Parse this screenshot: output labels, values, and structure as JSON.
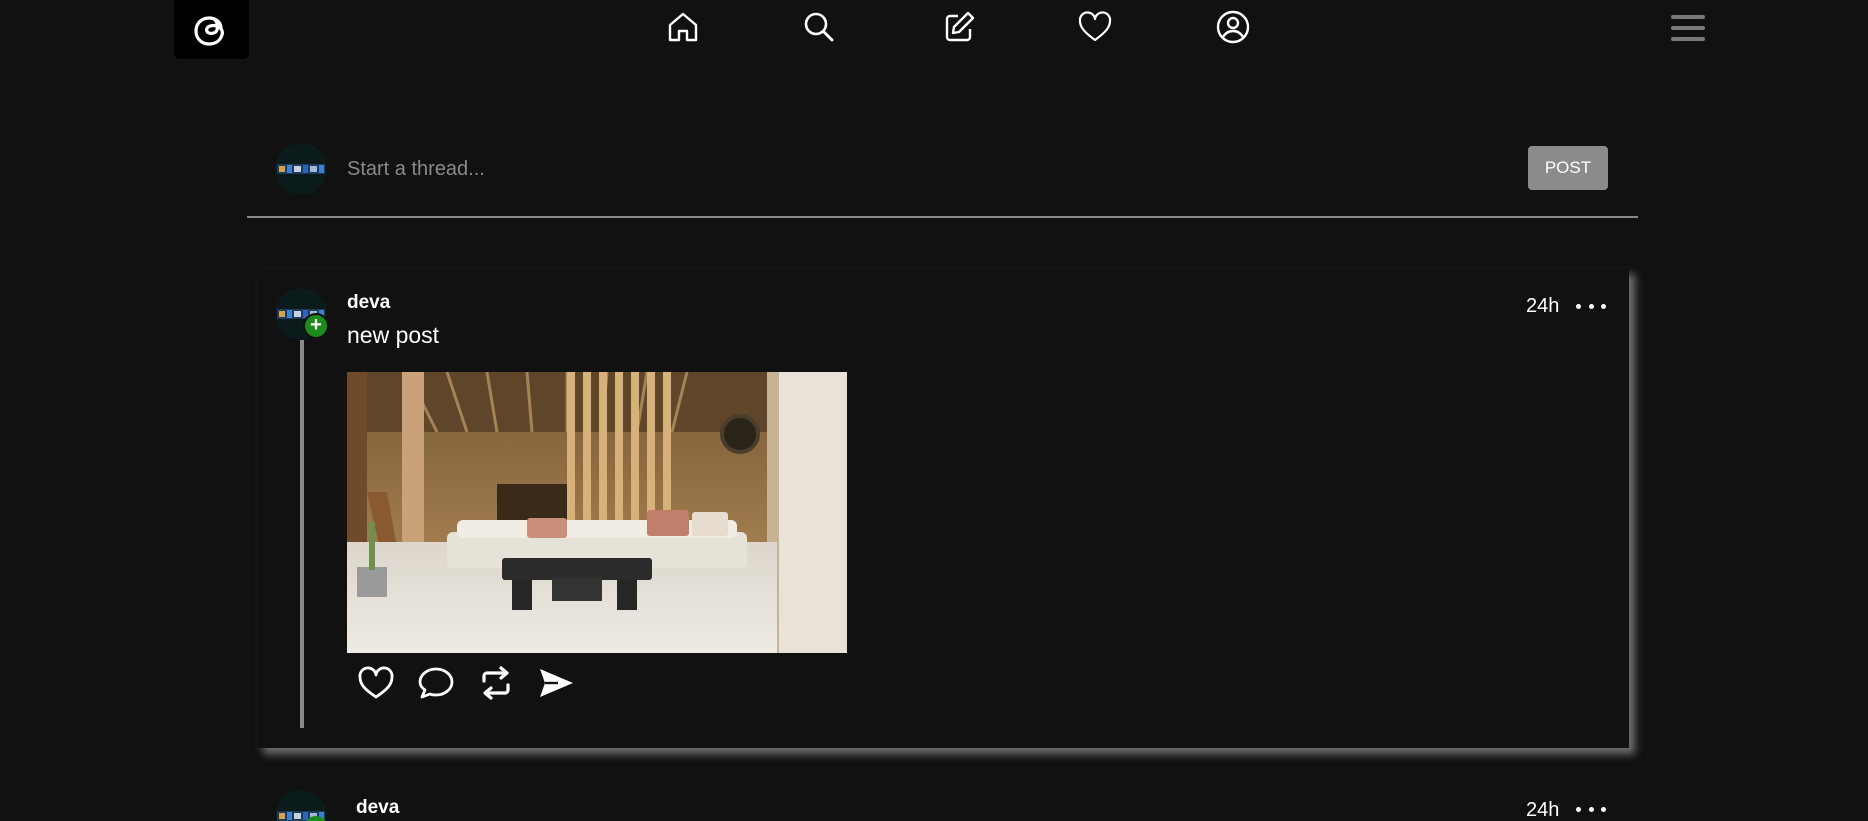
{
  "nav": {
    "logo": "threads-logo-icon",
    "icons": [
      "home-icon",
      "search-icon",
      "compose-icon",
      "heart-icon",
      "profile-icon"
    ],
    "menu": "hamburger-menu-icon"
  },
  "composer": {
    "placeholder": "Start a thread...",
    "post_label": "POST"
  },
  "posts": [
    {
      "username": "deva",
      "text": "new post",
      "time": "24h",
      "image": "living-room-photo",
      "actions": [
        "like-icon",
        "comment-icon",
        "repost-icon",
        "share-icon"
      ]
    },
    {
      "username": "deva",
      "time": "24h"
    }
  ],
  "colors": {
    "background": "#111111",
    "post_button": "#8b8b8b",
    "follow_badge": "#1c8a1c",
    "divider": "#8a8a8a"
  }
}
